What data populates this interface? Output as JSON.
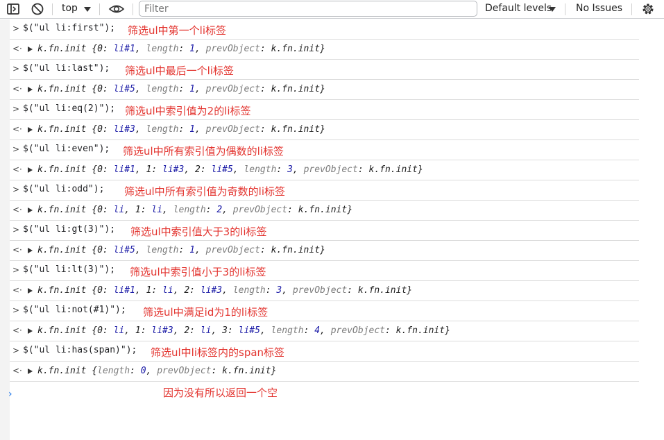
{
  "toolbar": {
    "context": "top",
    "filter_placeholder": "Filter",
    "levels": "Default levels",
    "issues": "No Issues"
  },
  "entries": [
    {
      "input": "$(\"ul li:first\");",
      "note": "筛选ul中第一个li标签",
      "output": [
        [
          "0",
          ":",
          " ",
          "li#1"
        ],
        [
          ", ",
          ""
        ],
        [
          "length",
          ": ",
          "",
          "1"
        ],
        [
          ", ",
          ""
        ],
        [
          "prevObject",
          ": ",
          "",
          "k.fn.init"
        ]
      ],
      "out_text": "k.fn.init {0: li#1, length: 1, prevObject: k.fn.init}"
    },
    {
      "input": "$(\"ul li:last\");",
      "note": "筛选ul中最后一个li标签",
      "out_text": "k.fn.init {0: li#5, length: 1, prevObject: k.fn.init}"
    },
    {
      "input": "$(\"ul li:eq(2)\");",
      "note": "筛选ul中索引值为2的li标签",
      "out_text": "k.fn.init {0: li#3, length: 1, prevObject: k.fn.init}"
    },
    {
      "input": "$(\"ul li:even\");",
      "note": "筛选ul中所有索引值为偶数的li标签",
      "out_text": "k.fn.init {0: li#1, 1: li#3, 2: li#5, length: 3, prevObject: k.fn.init}"
    },
    {
      "input": "$(\"ul li:odd\");",
      "note": "筛选ul中所有索引值为奇数的li标签",
      "out_text": "k.fn.init {0: li, 1: li, length: 2, prevObject: k.fn.init}"
    },
    {
      "input": "$(\"ul li:gt(3)\");",
      "note": "筛选ul中索引值大于3的li标签",
      "out_text": "k.fn.init {0: li#5, length: 1, prevObject: k.fn.init}"
    },
    {
      "input": "$(\"ul li:lt(3)\");",
      "note": "筛选ul中索引值小于3的li标签",
      "out_text": "k.fn.init {0: li#1, 1: li, 2: li#3, length: 3, prevObject: k.fn.init}"
    },
    {
      "input": "$(\"ul li:not(#1)\");",
      "note": "筛选ul中满足id为1的li标签",
      "out_text": "k.fn.init {0: li, 1: li#3, 2: li, 3: li#5, length: 4, prevObject: k.fn.init}"
    },
    {
      "input": "$(\"ul li:has(span)\");",
      "note": "筛选ul中li标签内的span标签",
      "out_text": "k.fn.init {length: 0, prevObject: k.fn.init}"
    }
  ],
  "final_note": "因为没有所以返回一个空",
  "colors": {
    "annotation": "#e3342f",
    "prompt": "#1a73e8",
    "value": "#1a1aa6"
  }
}
